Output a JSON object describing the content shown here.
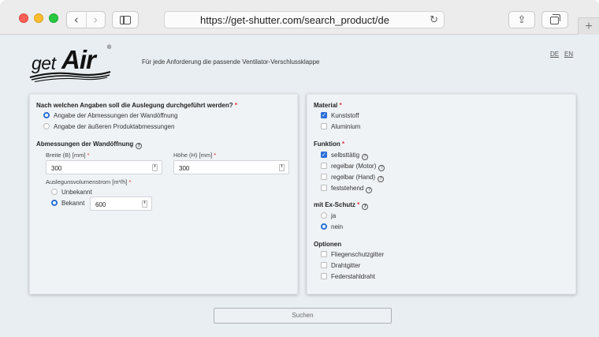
{
  "browser": {
    "url": "https://get-shutter.com/search_product/de",
    "back": "‹",
    "forward": "›",
    "share": "⇪",
    "newtab": "+"
  },
  "header": {
    "logo_get": "get",
    "logo_air": "Air",
    "logo_reg": "®",
    "tagline": "Für jede Anforderung die passende Ventilator-Verschlussklappe",
    "lang_de": "DE",
    "lang_en": "EN"
  },
  "left": {
    "question": "Nach welchen Angaben soll die Auslegung durchgeführt werden?",
    "required": "*",
    "option1": "Angabe der Abmessungen der Wandöffnung",
    "option2": "Angabe der äußeren Produktabmessungen",
    "selected_option": 1,
    "section_title": "Abmessungen der Wandöffnung",
    "width_label": "Breite (B) [mm]",
    "width_value": "300",
    "height_label": "Höhe (H) [mm]",
    "height_value": "300",
    "flow_label": "Auslegunsvolumenstrom [m³/h]",
    "flow_unknown": "Unbekannt",
    "flow_known": "Bekannt",
    "flow_selected": "known",
    "flow_value": "600"
  },
  "right": {
    "material_title": "Material",
    "material_plastic": "Kunststoff",
    "material_alu": "Aluminium",
    "function_title": "Funktion",
    "f_auto": "selbsttätig",
    "f_motor": "regelbar (Motor)",
    "f_hand": "regelbar (Hand)",
    "f_fixed": "feststehend",
    "ex_title": "mit Ex-Schutz",
    "ex_yes": "ja",
    "ex_no": "nein",
    "options_title": "Optionen",
    "opt_fly": "Fliegenschutzgitter",
    "opt_wire": "Drahtgitter",
    "opt_spring": "Federstahldraht",
    "required": "*"
  },
  "search_label": "Suchen",
  "colors": {
    "accent": "#2a6fd6",
    "required": "#dd3333",
    "page_bg": "#e9eef2"
  },
  "icons": {
    "help": "?",
    "check": "✓",
    "reload": "↻",
    "spinner": "⬍"
  }
}
